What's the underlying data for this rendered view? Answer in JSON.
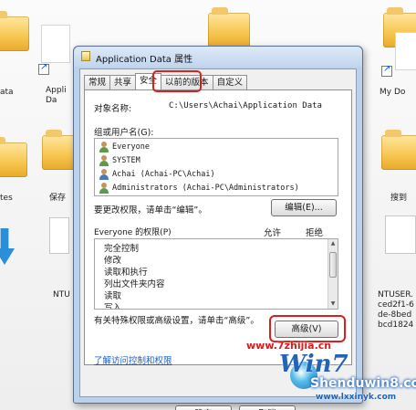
{
  "background": {
    "labels": {
      "left_top": "ata",
      "left_mid": "Appli\nDa",
      "left_low": "tes",
      "left_save": "保存",
      "left_ntu": "NTU",
      "right_mydoc": "My Do",
      "right_search": "搜到",
      "right_ntuser": "NTUSER.\nced2f1-6\nde-8bed\nbcd1824"
    }
  },
  "dialog": {
    "title": "Application Data 属性",
    "tabs": [
      "常规",
      "共享",
      "安全",
      "以前的版本",
      "自定义"
    ],
    "active_tab": "安全",
    "object_label": "对象名称:",
    "object_value": "C:\\Users\\Achai\\Application Data",
    "group_label": "组或用户名(G):",
    "users": [
      "Everyone",
      "SYSTEM",
      "Achai (Achai-PC\\Achai)",
      "Administrators (Achai-PC\\Administrators)"
    ],
    "change_hint": "要更改权限，请单击“编辑”。",
    "edit_button": "编辑(E)...",
    "perm_header": "Everyone 的权限(P)",
    "col_allow": "允许",
    "col_deny": "拒绝",
    "permissions": [
      "完全控制",
      "修改",
      "读取和执行",
      "列出文件夹内容",
      "读取",
      "写入"
    ],
    "advanced_text": "有关特殊权限或高级设置，请单击“高级”。",
    "advanced_button": "高级(V)",
    "learn_link": "了解访问控制和权限",
    "ok_button": "确定",
    "cancel_button": "取消"
  },
  "watermark": {
    "url_text": "www.7zhijia.cn",
    "win7_text": "Win7",
    "win8_text": "Shenduwin8.com",
    "win8_sub": "www.lxxinyk.com"
  },
  "colors": {
    "highlight": "#d8201f",
    "link": "#1a5fc7",
    "titlebar": "#c2d6ee"
  }
}
